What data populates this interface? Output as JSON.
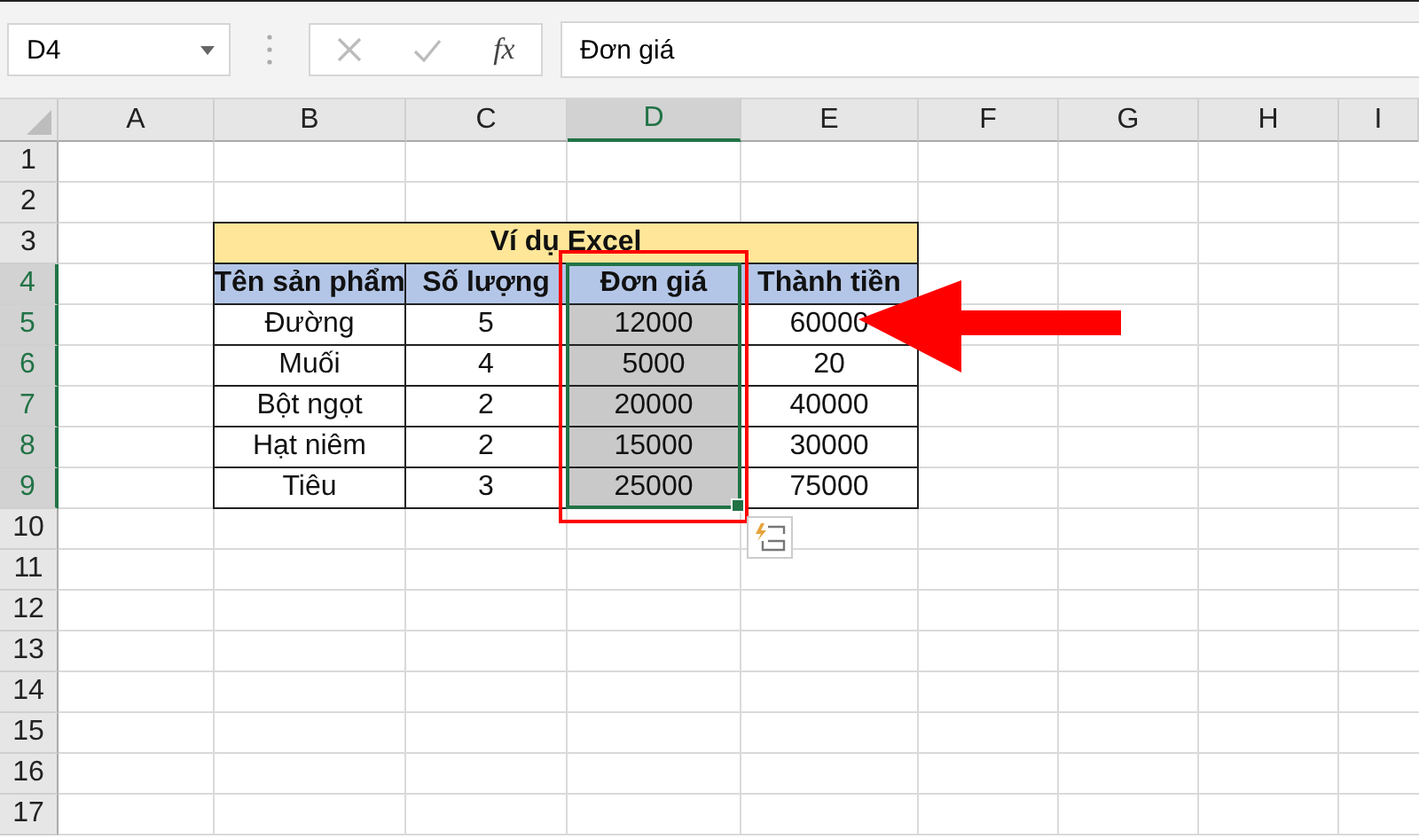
{
  "formula_bar": {
    "name_box": "D4",
    "function_label": "fx",
    "formula": "Đơn giá"
  },
  "columns": [
    {
      "label": "A",
      "selected": false
    },
    {
      "label": "B",
      "selected": false
    },
    {
      "label": "C",
      "selected": false
    },
    {
      "label": "D",
      "selected": true
    },
    {
      "label": "E",
      "selected": false
    },
    {
      "label": "F",
      "selected": false
    },
    {
      "label": "G",
      "selected": false
    },
    {
      "label": "H",
      "selected": false
    },
    {
      "label": "I",
      "selected": false
    }
  ],
  "rows": [
    {
      "label": "1",
      "selected": false
    },
    {
      "label": "2",
      "selected": false
    },
    {
      "label": "3",
      "selected": false
    },
    {
      "label": "4",
      "selected": true
    },
    {
      "label": "5",
      "selected": true
    },
    {
      "label": "6",
      "selected": true
    },
    {
      "label": "7",
      "selected": true
    },
    {
      "label": "8",
      "selected": true
    },
    {
      "label": "9",
      "selected": true
    },
    {
      "label": "10",
      "selected": false
    },
    {
      "label": "11",
      "selected": false
    },
    {
      "label": "12",
      "selected": false
    },
    {
      "label": "13",
      "selected": false
    },
    {
      "label": "14",
      "selected": false
    },
    {
      "label": "15",
      "selected": false
    },
    {
      "label": "16",
      "selected": false
    },
    {
      "label": "17",
      "selected": false
    }
  ],
  "table": {
    "title": "Ví dụ Excel",
    "headers": [
      "Tên sản phẩm",
      "Số lượng",
      "Đơn giá",
      "Thành tiền"
    ],
    "rows": [
      [
        "Đường",
        "5",
        "12000",
        "60000"
      ],
      [
        "Muối",
        "4",
        "5000",
        "20"
      ],
      [
        "Bột ngọt",
        "2",
        "20000",
        "40000"
      ],
      [
        "Hạt niêm",
        "2",
        "15000",
        "30000"
      ],
      [
        "Tiêu",
        "3",
        "25000",
        "75000"
      ]
    ]
  }
}
